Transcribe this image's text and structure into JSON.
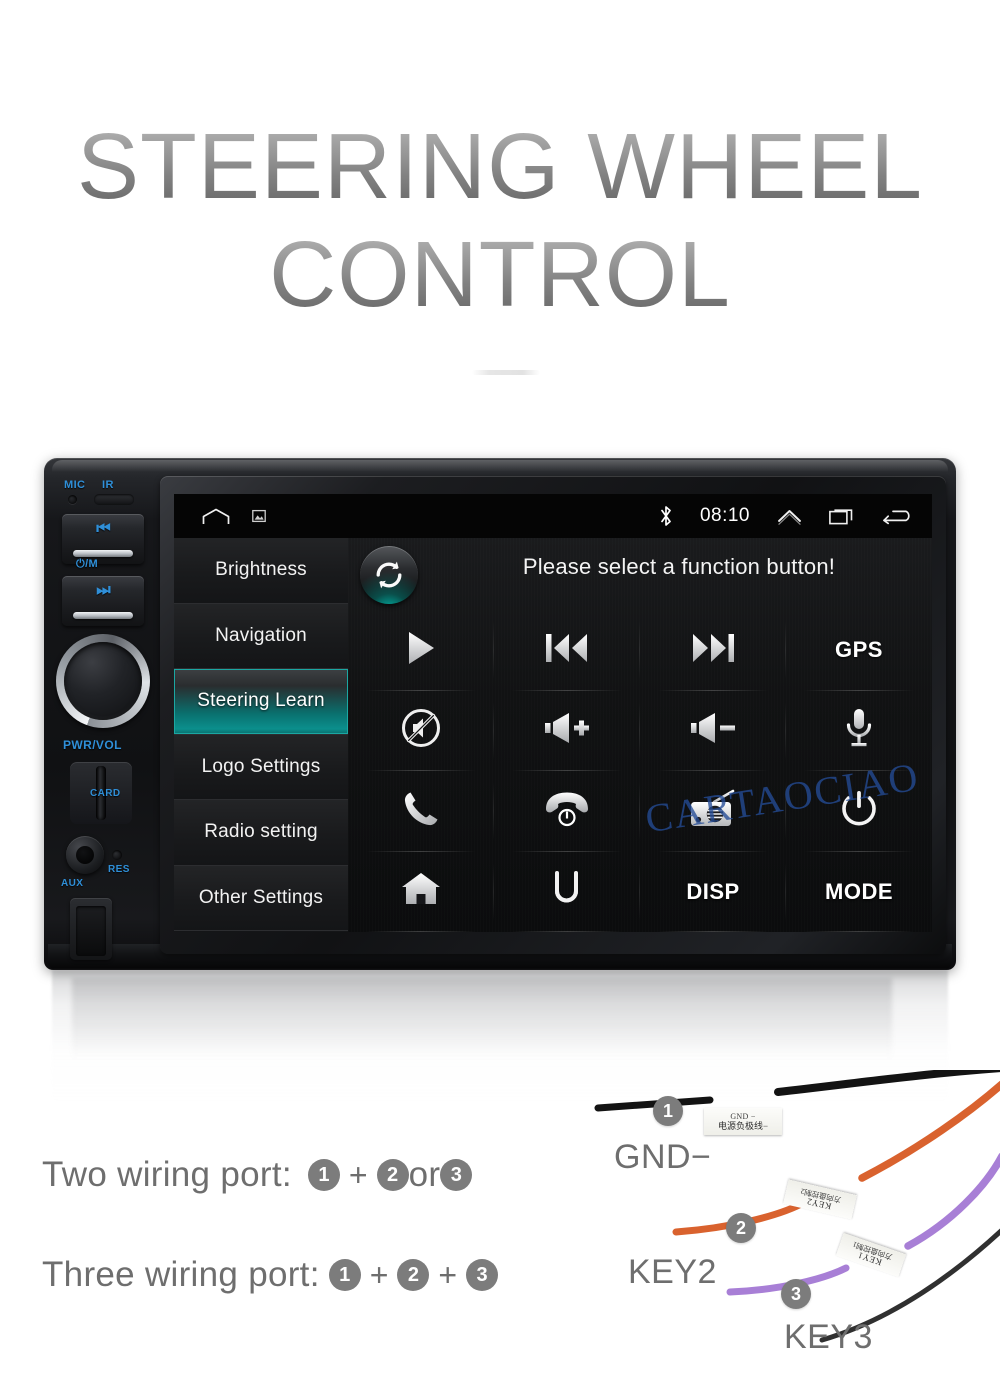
{
  "title": {
    "line1": "STEERING WHEEL",
    "line2": "CONTROL"
  },
  "colors": {
    "title_gradient_top": "#c9c9c9",
    "title_gradient_bottom": "#6e6e6e",
    "accent_teal": "#0b8f8c",
    "hardware_label_blue": "#2f8fd8",
    "badge_gray": "#7c7c7c",
    "body_text_gray": "#6e6e6e",
    "watermark_blue": "#244c96",
    "wire_1": "#141414",
    "wire_2": "#d9622e",
    "wire_3": "#a87fd6"
  },
  "head_unit": {
    "hardware_labels": {
      "mic": "MIC",
      "ir": "IR",
      "prev": "⏮",
      "power_mode": "⏻/M",
      "next": "⏭",
      "knob": "PWR/VOL",
      "card": "CARD",
      "aux": "AUX",
      "res": "RES"
    },
    "screen": {
      "status_bar": {
        "home_icon": "home-icon",
        "screenshot_icon": "screenshot-icon",
        "bluetooth_icon": "bluetooth-icon",
        "time": "08:10",
        "chevron_up_icon": "chevron-up-icon",
        "recents_icon": "recents-icon",
        "back_icon": "back-arrow-icon"
      },
      "sidebar": {
        "items": [
          {
            "label": "Brightness",
            "active": false
          },
          {
            "label": "Navigation",
            "active": false
          },
          {
            "label": "Steering Learn",
            "active": true
          },
          {
            "label": "Logo Settings",
            "active": false
          },
          {
            "label": "Radio setting",
            "active": false
          },
          {
            "label": "Other Settings",
            "active": false
          }
        ]
      },
      "content": {
        "sync_button_icon": "sync-refresh-icon",
        "prompt": "Please select a function button!",
        "watermark": "CARTAOCIAO",
        "buttons": [
          {
            "name": "play-icon",
            "type": "icon",
            "label": ""
          },
          {
            "name": "previous-icon",
            "type": "icon",
            "label": ""
          },
          {
            "name": "next-icon",
            "type": "icon",
            "label": ""
          },
          {
            "name": "gps-button",
            "type": "text",
            "label": "GPS"
          },
          {
            "name": "mute-icon",
            "type": "icon",
            "label": ""
          },
          {
            "name": "volume-up-icon",
            "type": "icon",
            "label": ""
          },
          {
            "name": "volume-down-icon",
            "type": "icon",
            "label": ""
          },
          {
            "name": "microphone-icon",
            "type": "icon",
            "label": ""
          },
          {
            "name": "call-answer-icon",
            "type": "icon",
            "label": ""
          },
          {
            "name": "call-end-icon",
            "type": "icon",
            "label": ""
          },
          {
            "name": "radio-icon",
            "type": "icon",
            "label": ""
          },
          {
            "name": "power-icon",
            "type": "icon",
            "label": ""
          },
          {
            "name": "home-icon",
            "type": "icon",
            "label": ""
          },
          {
            "name": "return-icon",
            "type": "icon",
            "label": ""
          },
          {
            "name": "disp-button",
            "type": "text",
            "label": "DISP"
          },
          {
            "name": "mode-button",
            "type": "text",
            "label": "MODE"
          }
        ]
      }
    }
  },
  "wiring": {
    "two_port": {
      "label": "Two wiring port:",
      "badge_a": "1",
      "plus": "+",
      "badge_b": "2",
      "or": "or",
      "badge_c": "3"
    },
    "three_port": {
      "label": "Three wiring port:",
      "badge_a": "1",
      "plus1": "+",
      "badge_b": "2",
      "plus2": "+",
      "badge_c": "3"
    },
    "wires": [
      {
        "badge": "1",
        "name": "GND−",
        "tag_line1": "GND −",
        "tag_line2": "电源负极线−"
      },
      {
        "badge": "2",
        "name": "KEY2",
        "tag_line1": "KEY2",
        "tag_line2": "方向盘控制2"
      },
      {
        "badge": "3",
        "name": "KEY3",
        "tag_line1": "KEY1",
        "tag_line2": "方向盘控制1"
      }
    ]
  }
}
